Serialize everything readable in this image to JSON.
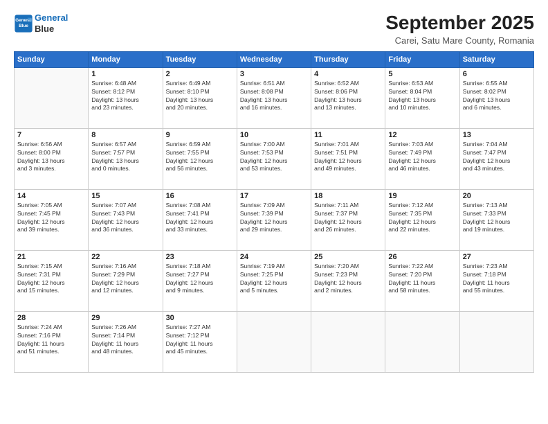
{
  "logo": {
    "line1": "General",
    "line2": "Blue"
  },
  "title": "September 2025",
  "subtitle": "Carei, Satu Mare County, Romania",
  "weekdays": [
    "Sunday",
    "Monday",
    "Tuesday",
    "Wednesday",
    "Thursday",
    "Friday",
    "Saturday"
  ],
  "weeks": [
    [
      {
        "day": "",
        "info": ""
      },
      {
        "day": "1",
        "info": "Sunrise: 6:48 AM\nSunset: 8:12 PM\nDaylight: 13 hours\nand 23 minutes."
      },
      {
        "day": "2",
        "info": "Sunrise: 6:49 AM\nSunset: 8:10 PM\nDaylight: 13 hours\nand 20 minutes."
      },
      {
        "day": "3",
        "info": "Sunrise: 6:51 AM\nSunset: 8:08 PM\nDaylight: 13 hours\nand 16 minutes."
      },
      {
        "day": "4",
        "info": "Sunrise: 6:52 AM\nSunset: 8:06 PM\nDaylight: 13 hours\nand 13 minutes."
      },
      {
        "day": "5",
        "info": "Sunrise: 6:53 AM\nSunset: 8:04 PM\nDaylight: 13 hours\nand 10 minutes."
      },
      {
        "day": "6",
        "info": "Sunrise: 6:55 AM\nSunset: 8:02 PM\nDaylight: 13 hours\nand 6 minutes."
      }
    ],
    [
      {
        "day": "7",
        "info": "Sunrise: 6:56 AM\nSunset: 8:00 PM\nDaylight: 13 hours\nand 3 minutes."
      },
      {
        "day": "8",
        "info": "Sunrise: 6:57 AM\nSunset: 7:57 PM\nDaylight: 13 hours\nand 0 minutes."
      },
      {
        "day": "9",
        "info": "Sunrise: 6:59 AM\nSunset: 7:55 PM\nDaylight: 12 hours\nand 56 minutes."
      },
      {
        "day": "10",
        "info": "Sunrise: 7:00 AM\nSunset: 7:53 PM\nDaylight: 12 hours\nand 53 minutes."
      },
      {
        "day": "11",
        "info": "Sunrise: 7:01 AM\nSunset: 7:51 PM\nDaylight: 12 hours\nand 49 minutes."
      },
      {
        "day": "12",
        "info": "Sunrise: 7:03 AM\nSunset: 7:49 PM\nDaylight: 12 hours\nand 46 minutes."
      },
      {
        "day": "13",
        "info": "Sunrise: 7:04 AM\nSunset: 7:47 PM\nDaylight: 12 hours\nand 43 minutes."
      }
    ],
    [
      {
        "day": "14",
        "info": "Sunrise: 7:05 AM\nSunset: 7:45 PM\nDaylight: 12 hours\nand 39 minutes."
      },
      {
        "day": "15",
        "info": "Sunrise: 7:07 AM\nSunset: 7:43 PM\nDaylight: 12 hours\nand 36 minutes."
      },
      {
        "day": "16",
        "info": "Sunrise: 7:08 AM\nSunset: 7:41 PM\nDaylight: 12 hours\nand 33 minutes."
      },
      {
        "day": "17",
        "info": "Sunrise: 7:09 AM\nSunset: 7:39 PM\nDaylight: 12 hours\nand 29 minutes."
      },
      {
        "day": "18",
        "info": "Sunrise: 7:11 AM\nSunset: 7:37 PM\nDaylight: 12 hours\nand 26 minutes."
      },
      {
        "day": "19",
        "info": "Sunrise: 7:12 AM\nSunset: 7:35 PM\nDaylight: 12 hours\nand 22 minutes."
      },
      {
        "day": "20",
        "info": "Sunrise: 7:13 AM\nSunset: 7:33 PM\nDaylight: 12 hours\nand 19 minutes."
      }
    ],
    [
      {
        "day": "21",
        "info": "Sunrise: 7:15 AM\nSunset: 7:31 PM\nDaylight: 12 hours\nand 15 minutes."
      },
      {
        "day": "22",
        "info": "Sunrise: 7:16 AM\nSunset: 7:29 PM\nDaylight: 12 hours\nand 12 minutes."
      },
      {
        "day": "23",
        "info": "Sunrise: 7:18 AM\nSunset: 7:27 PM\nDaylight: 12 hours\nand 9 minutes."
      },
      {
        "day": "24",
        "info": "Sunrise: 7:19 AM\nSunset: 7:25 PM\nDaylight: 12 hours\nand 5 minutes."
      },
      {
        "day": "25",
        "info": "Sunrise: 7:20 AM\nSunset: 7:23 PM\nDaylight: 12 hours\nand 2 minutes."
      },
      {
        "day": "26",
        "info": "Sunrise: 7:22 AM\nSunset: 7:20 PM\nDaylight: 11 hours\nand 58 minutes."
      },
      {
        "day": "27",
        "info": "Sunrise: 7:23 AM\nSunset: 7:18 PM\nDaylight: 11 hours\nand 55 minutes."
      }
    ],
    [
      {
        "day": "28",
        "info": "Sunrise: 7:24 AM\nSunset: 7:16 PM\nDaylight: 11 hours\nand 51 minutes."
      },
      {
        "day": "29",
        "info": "Sunrise: 7:26 AM\nSunset: 7:14 PM\nDaylight: 11 hours\nand 48 minutes."
      },
      {
        "day": "30",
        "info": "Sunrise: 7:27 AM\nSunset: 7:12 PM\nDaylight: 11 hours\nand 45 minutes."
      },
      {
        "day": "",
        "info": ""
      },
      {
        "day": "",
        "info": ""
      },
      {
        "day": "",
        "info": ""
      },
      {
        "day": "",
        "info": ""
      }
    ]
  ]
}
